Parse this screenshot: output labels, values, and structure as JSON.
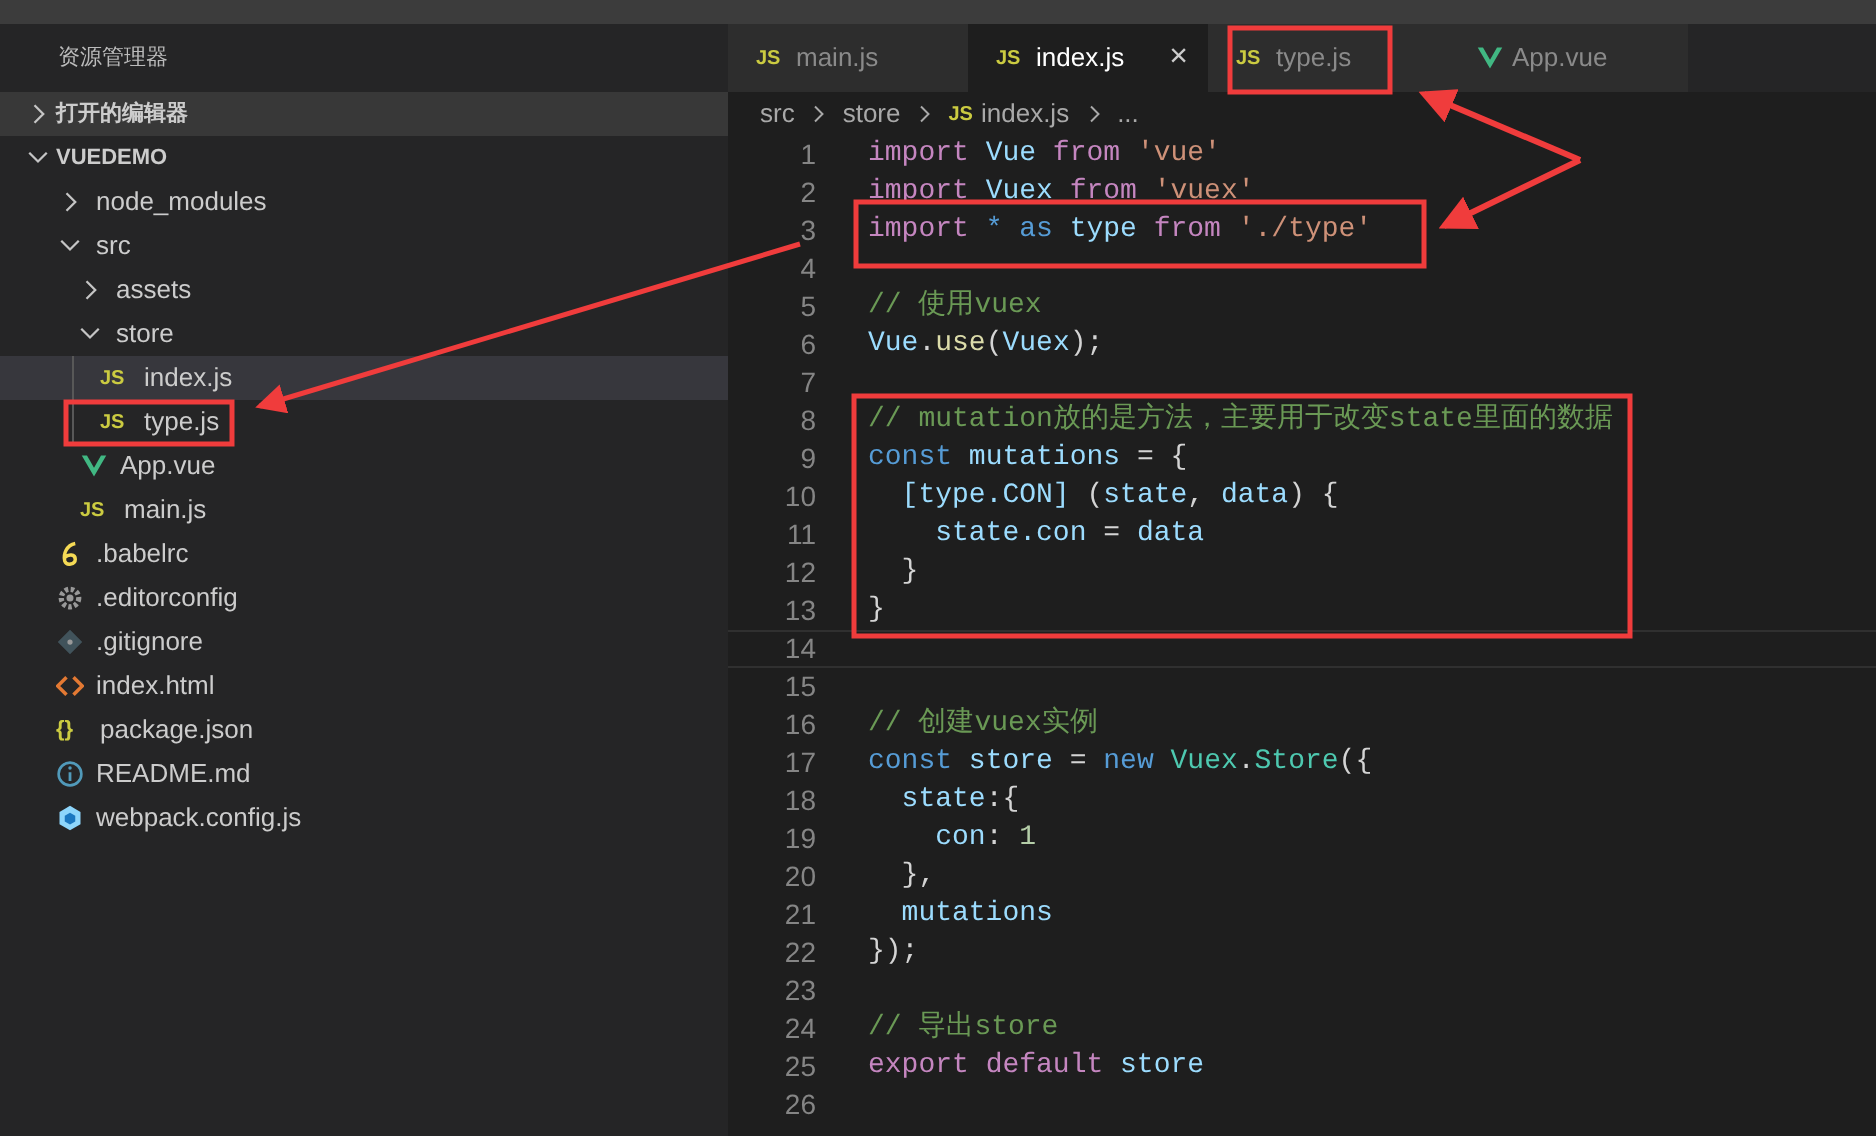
{
  "sidebar": {
    "title": "资源管理器",
    "sections": [
      {
        "label": "打开的编辑器",
        "expanded": false
      },
      {
        "label": "VUEDEMO",
        "expanded": true
      }
    ],
    "tree": [
      {
        "name": "node_modules",
        "kind": "folder",
        "expanded": false,
        "selected": false
      },
      {
        "name": "src",
        "kind": "folder",
        "expanded": true,
        "selected": false,
        "children": [
          {
            "name": "assets",
            "kind": "folder",
            "expanded": false,
            "selected": false
          },
          {
            "name": "store",
            "kind": "folder",
            "expanded": true,
            "selected": false,
            "children": [
              {
                "name": "index.js",
                "kind": "js",
                "badge": "JS",
                "selected": true
              },
              {
                "name": "type.js",
                "kind": "js",
                "badge": "JS",
                "selected": false
              }
            ]
          },
          {
            "name": "App.vue",
            "kind": "vue",
            "selected": false
          },
          {
            "name": "main.js",
            "kind": "js",
            "badge": "JS",
            "selected": false
          }
        ]
      },
      {
        "name": ".babelrc",
        "kind": "babel",
        "selected": false
      },
      {
        "name": ".editorconfig",
        "kind": "config",
        "selected": false
      },
      {
        "name": ".gitignore",
        "kind": "git",
        "selected": false
      },
      {
        "name": "index.html",
        "kind": "html",
        "selected": false
      },
      {
        "name": "package.json",
        "kind": "json",
        "badge": "{}",
        "selected": false
      },
      {
        "name": "README.md",
        "kind": "info",
        "selected": false
      },
      {
        "name": "webpack.config.js",
        "kind": "webpack",
        "selected": false
      }
    ]
  },
  "tabs": [
    {
      "label": "main.js",
      "kind": "js",
      "badge": "JS",
      "selected": false
    },
    {
      "label": "index.js",
      "kind": "js",
      "badge": "JS",
      "selected": true,
      "close": "×"
    },
    {
      "label": "type.js",
      "kind": "js",
      "badge": "JS",
      "selected": false
    },
    {
      "label": "App.vue",
      "kind": "vue",
      "selected": false
    }
  ],
  "breadcrumb": [
    {
      "text": "src"
    },
    {
      "text": "store"
    },
    {
      "text": "index.js",
      "badge": "JS"
    },
    {
      "text": "..."
    }
  ],
  "code": [
    {
      "number": "1",
      "tokens": [
        {
          "keyword": "import "
        },
        {
          "variable": "Vue "
        },
        {
          "keyword": "from "
        },
        {
          "string": "'vue'"
        }
      ]
    },
    {
      "number": "2",
      "tokens": [
        {
          "keyword": "import "
        },
        {
          "variable": "Vuex "
        },
        {
          "keyword": "from "
        },
        {
          "string": "'vuex'"
        }
      ]
    },
    {
      "number": "3",
      "tokens": [
        {
          "keyword": "import "
        },
        {
          "storage": "* as "
        },
        {
          "variable": "type "
        },
        {
          "keyword": "from "
        },
        {
          "string": "'./type'"
        }
      ]
    },
    {
      "number": "4"
    },
    {
      "number": "5",
      "tokens": [
        {
          "comment": "// 使用vuex"
        }
      ]
    },
    {
      "number": "6",
      "tokens": [
        {
          "variable": "Vue"
        },
        {
          "plain": "."
        },
        {
          "function": "use"
        },
        {
          "plain": "("
        },
        {
          "variable": "Vuex"
        },
        {
          "plain": ");"
        }
      ]
    },
    {
      "number": "7"
    },
    {
      "number": "8",
      "tokens": [
        {
          "comment": "// mutation放的是方法，主要用于改变state里面的数据"
        }
      ]
    },
    {
      "number": "9",
      "tokens": [
        {
          "storage": "const "
        },
        {
          "variable": "mutations"
        },
        {
          "plain": " = {"
        }
      ]
    },
    {
      "number": "10",
      "tokens": [
        {
          "variable": "  [type.CON]"
        },
        {
          "plain": " ("
        },
        {
          "variable": "state"
        },
        {
          "plain": ", "
        },
        {
          "variable": "data"
        },
        {
          "plain": ") {"
        }
      ]
    },
    {
      "number": "11",
      "tokens": [
        {
          "variable": "    state.con"
        },
        {
          "plain": " = "
        },
        {
          "variable": "data"
        }
      ]
    },
    {
      "number": "12",
      "tokens": [
        {
          "plain": "  }"
        }
      ]
    },
    {
      "number": "13",
      "tokens": [
        {
          "plain": "}"
        }
      ]
    },
    {
      "number": "14"
    },
    {
      "number": "15"
    },
    {
      "number": "16",
      "tokens": [
        {
          "comment": "// 创建vuex实例"
        }
      ]
    },
    {
      "number": "17",
      "tokens": [
        {
          "storage": "const "
        },
        {
          "variable": "store"
        },
        {
          "plain": " = "
        },
        {
          "storage": "new "
        },
        {
          "class": "Vuex"
        },
        {
          "plain": "."
        },
        {
          "class": "Store"
        },
        {
          "plain": "({"
        }
      ]
    },
    {
      "number": "18",
      "tokens": [
        {
          "variable": "  state"
        },
        {
          "plain": ":{"
        }
      ]
    },
    {
      "number": "19",
      "tokens": [
        {
          "variable": "    con"
        },
        {
          "plain": ": "
        },
        {
          "number": "1"
        }
      ]
    },
    {
      "number": "20",
      "tokens": [
        {
          "plain": "  },"
        }
      ]
    },
    {
      "number": "21",
      "tokens": [
        {
          "variable": "  mutations"
        }
      ]
    },
    {
      "number": "22",
      "tokens": [
        {
          "plain": "});"
        }
      ]
    },
    {
      "number": "23"
    },
    {
      "number": "24",
      "tokens": [
        {
          "comment": "// 导出store"
        }
      ]
    },
    {
      "number": "25",
      "tokens": [
        {
          "keyword": "export "
        },
        {
          "keyword": "default "
        },
        {
          "variable": "store"
        }
      ]
    },
    {
      "number": "26"
    }
  ]
}
